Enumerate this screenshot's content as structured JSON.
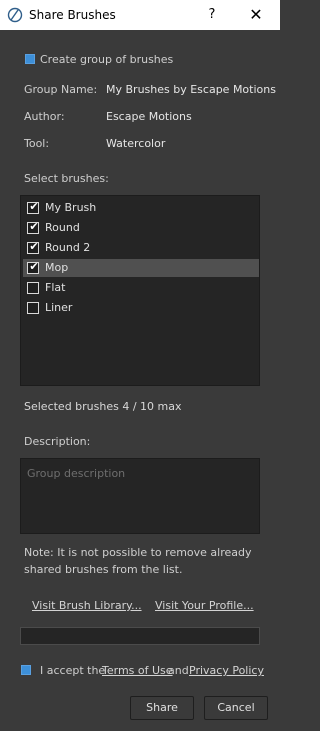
{
  "window": {
    "title": "Share Brushes",
    "help": "?",
    "close": "✕"
  },
  "group": {
    "checkbox_label": "Create group of brushes",
    "checked": true,
    "name_label": "Group Name:",
    "name_value": "My Brushes by Escape Motions",
    "author_label": "Author:",
    "author_value": "Escape Motions",
    "tool_label": "Tool:",
    "tool_value": "Watercolor"
  },
  "brushes": {
    "heading": "Select brushes:",
    "items": [
      {
        "label": "My Brush",
        "checked": true,
        "selected": false
      },
      {
        "label": "Round",
        "checked": true,
        "selected": false
      },
      {
        "label": "Round 2",
        "checked": true,
        "selected": false
      },
      {
        "label": "Mop",
        "checked": true,
        "selected": true
      },
      {
        "label": "Flat",
        "checked": false,
        "selected": false
      },
      {
        "label": "Liner",
        "checked": false,
        "selected": false
      }
    ],
    "count_text": "Selected brushes 4 / 10 max"
  },
  "description": {
    "label": "Description:",
    "placeholder": "Group description"
  },
  "note": {
    "line1": "Note: It is not possible to remove already",
    "line2": "shared brushes from the list."
  },
  "links": {
    "library": "Visit Brush Library...",
    "profile": "Visit Your Profile..."
  },
  "progress": {
    "value": 0
  },
  "terms": {
    "checked": true,
    "prefix": "I accept the",
    "terms_link": "Terms of Use",
    "and": "and",
    "privacy_link": "Privacy Policy"
  },
  "buttons": {
    "share": "Share",
    "cancel": "Cancel"
  },
  "colors": {
    "background": "#3a3a3a",
    "accent": "#3d8fd8"
  }
}
